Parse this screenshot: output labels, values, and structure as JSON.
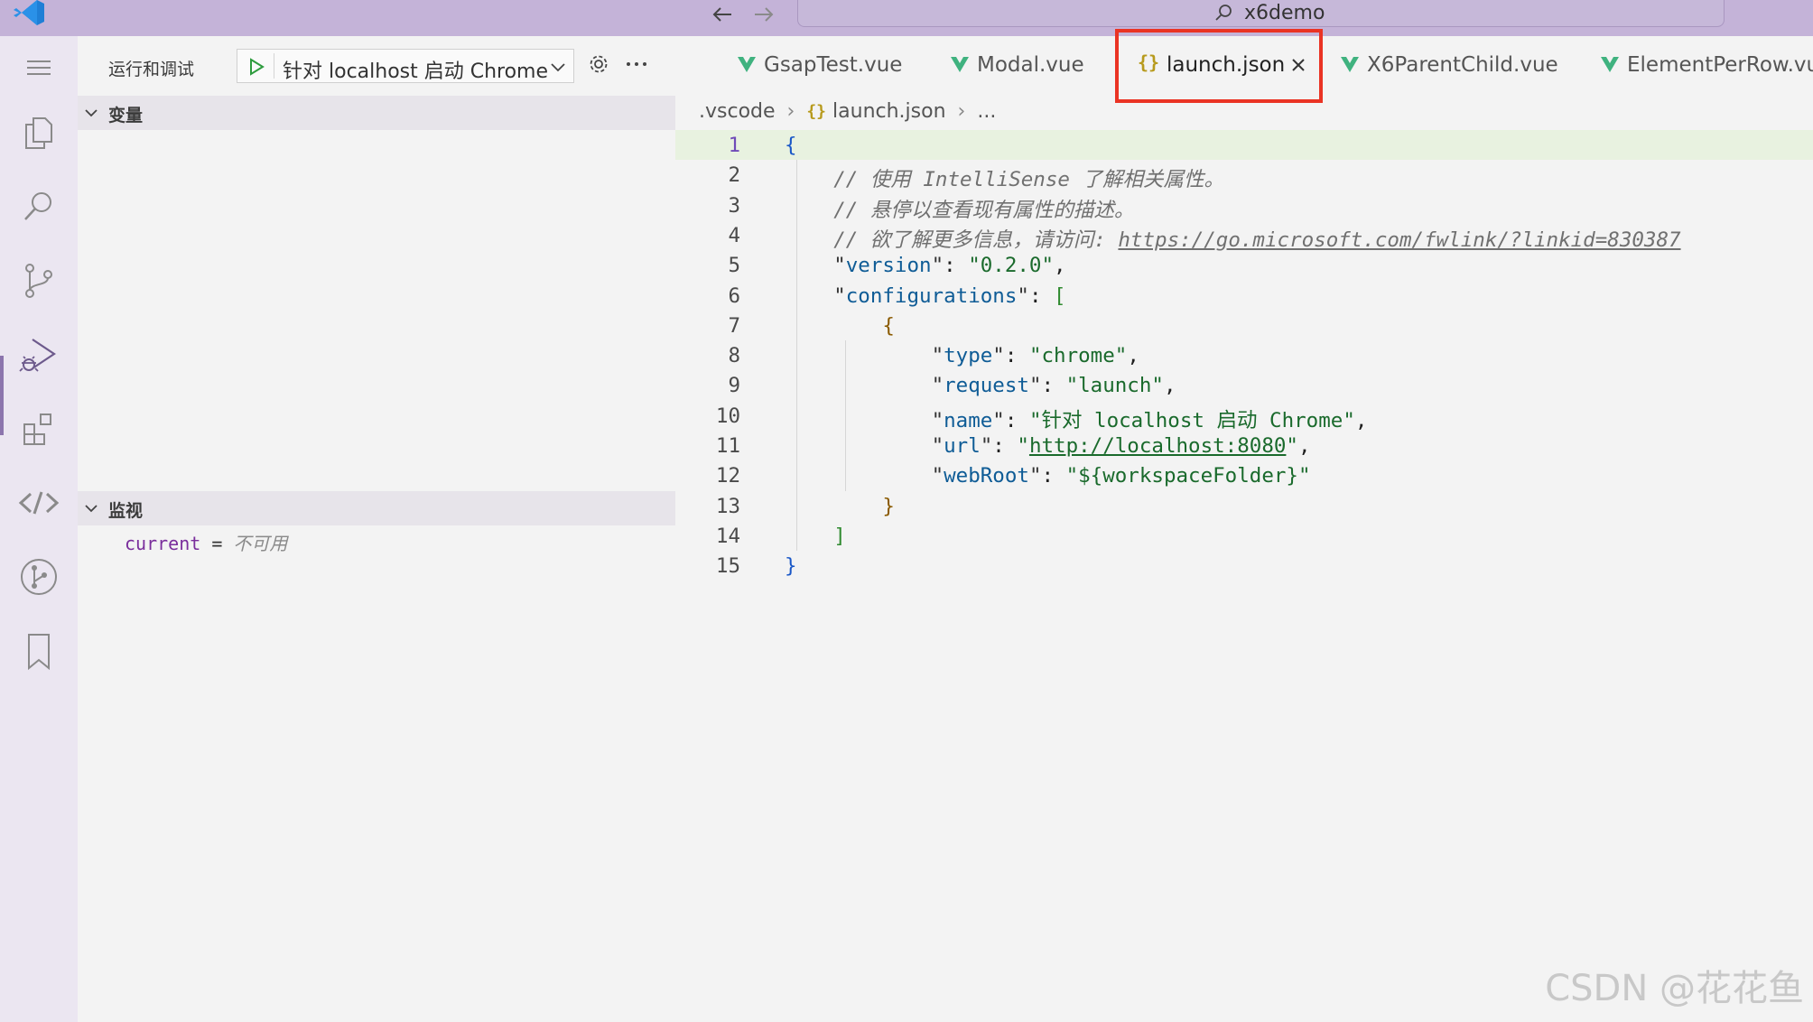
{
  "titlebar": {
    "search_text": "x6demo"
  },
  "sidebar": {
    "title": "运行和调试",
    "debug_config": "针对 localhost 启动 Chrome",
    "sections": {
      "variables": "变量",
      "watch": "监视"
    },
    "watch_items": [
      {
        "name": "current",
        "op": " = ",
        "value": "不可用"
      }
    ]
  },
  "tabs": [
    {
      "label": "GsapTest.vue",
      "icon": "vue-icon"
    },
    {
      "label": "Modal.vue",
      "icon": "vue-icon"
    },
    {
      "label": "launch.json",
      "icon": "json-icon",
      "json_glyph": "{}",
      "active": true
    },
    {
      "label": "X6ParentChild.vue",
      "icon": "vue-icon"
    },
    {
      "label": "ElementPerRow.vue",
      "icon": "vue-icon"
    }
  ],
  "breadcrumb": {
    "folder": ".vscode",
    "json_glyph": "{}",
    "file": "launch.json",
    "ellipsis": "..."
  },
  "editor": {
    "line_numbers": [
      "1",
      "2",
      "3",
      "4",
      "5",
      "6",
      "7",
      "8",
      "9",
      "10",
      "11",
      "12",
      "13",
      "14",
      "15"
    ],
    "lines": [
      {
        "indent": "",
        "tokens": [
          {
            "t": "{",
            "c": "tk-brace"
          }
        ]
      },
      {
        "indent": "    ",
        "tokens": [
          {
            "t": "// 使用 IntelliSense 了解相关属性。",
            "c": "tk-com"
          }
        ]
      },
      {
        "indent": "    ",
        "tokens": [
          {
            "t": "// 悬停以查看现有属性的描述。",
            "c": "tk-com"
          }
        ]
      },
      {
        "indent": "    ",
        "tokens": [
          {
            "t": "// 欲了解更多信息，请访问: ",
            "c": "tk-com"
          },
          {
            "t": "https://go.microsoft.com/fwlink/?linkid=830387",
            "c": "tk-com tk-link"
          }
        ]
      },
      {
        "indent": "    ",
        "tokens": [
          {
            "t": "\"",
            "c": "tk-keyq"
          },
          {
            "t": "version",
            "c": "tk-key"
          },
          {
            "t": "\"",
            "c": "tk-keyq"
          },
          {
            "t": ": ",
            "c": "tk-punc"
          },
          {
            "t": "\"0.2.0\"",
            "c": "tk-str"
          },
          {
            "t": ",",
            "c": "tk-punc"
          }
        ]
      },
      {
        "indent": "    ",
        "tokens": [
          {
            "t": "\"",
            "c": "tk-keyq"
          },
          {
            "t": "configurations",
            "c": "tk-key"
          },
          {
            "t": "\"",
            "c": "tk-keyq"
          },
          {
            "t": ": ",
            "c": "tk-punc"
          },
          {
            "t": "[",
            "c": "tk-brack"
          }
        ]
      },
      {
        "indent": "        ",
        "tokens": [
          {
            "t": "{",
            "c": "tk-brace2"
          }
        ]
      },
      {
        "indent": "            ",
        "tokens": [
          {
            "t": "\"",
            "c": "tk-keyq"
          },
          {
            "t": "type",
            "c": "tk-key"
          },
          {
            "t": "\"",
            "c": "tk-keyq"
          },
          {
            "t": ": ",
            "c": "tk-punc"
          },
          {
            "t": "\"chrome\"",
            "c": "tk-str"
          },
          {
            "t": ",",
            "c": "tk-punc"
          }
        ]
      },
      {
        "indent": "            ",
        "tokens": [
          {
            "t": "\"",
            "c": "tk-keyq"
          },
          {
            "t": "request",
            "c": "tk-key"
          },
          {
            "t": "\"",
            "c": "tk-keyq"
          },
          {
            "t": ": ",
            "c": "tk-punc"
          },
          {
            "t": "\"launch\"",
            "c": "tk-str"
          },
          {
            "t": ",",
            "c": "tk-punc"
          }
        ]
      },
      {
        "indent": "            ",
        "tokens": [
          {
            "t": "\"",
            "c": "tk-keyq"
          },
          {
            "t": "name",
            "c": "tk-key"
          },
          {
            "t": "\"",
            "c": "tk-keyq"
          },
          {
            "t": ": ",
            "c": "tk-punc"
          },
          {
            "t": "\"针对 localhost 启动 Chrome\"",
            "c": "tk-str"
          },
          {
            "t": ",",
            "c": "tk-punc"
          }
        ]
      },
      {
        "indent": "            ",
        "tokens": [
          {
            "t": "\"",
            "c": "tk-keyq"
          },
          {
            "t": "url",
            "c": "tk-key"
          },
          {
            "t": "\"",
            "c": "tk-keyq"
          },
          {
            "t": ": ",
            "c": "tk-punc"
          },
          {
            "t": "\"",
            "c": "tk-str"
          },
          {
            "t": "http://localhost:8080",
            "c": "tk-str tk-link"
          },
          {
            "t": "\"",
            "c": "tk-str"
          },
          {
            "t": ",",
            "c": "tk-punc"
          }
        ]
      },
      {
        "indent": "            ",
        "tokens": [
          {
            "t": "\"",
            "c": "tk-keyq"
          },
          {
            "t": "webRoot",
            "c": "tk-key"
          },
          {
            "t": "\"",
            "c": "tk-keyq"
          },
          {
            "t": ": ",
            "c": "tk-punc"
          },
          {
            "t": "\"${workspaceFolder}\"",
            "c": "tk-str"
          }
        ]
      },
      {
        "indent": "        ",
        "tokens": [
          {
            "t": "}",
            "c": "tk-brace2"
          }
        ]
      },
      {
        "indent": "    ",
        "tokens": [
          {
            "t": "]",
            "c": "tk-brack"
          }
        ]
      },
      {
        "indent": "",
        "tokens": [
          {
            "t": "}",
            "c": "tk-brace"
          }
        ]
      }
    ]
  },
  "watermark": "CSDN @花花鱼",
  "colors": {
    "titlebar": "#c4b3d8",
    "accent": "#8c75ad",
    "highlight": "#ea3323",
    "vue_green": "#3fb27f",
    "json_yellow": "#b79a1c"
  }
}
